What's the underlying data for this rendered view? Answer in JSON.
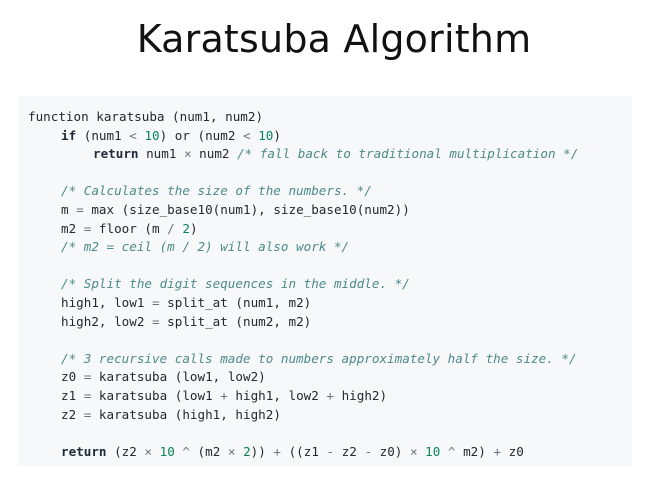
{
  "slide": {
    "title": "Karatsuba Algorithm"
  },
  "code": {
    "l1": {
      "a": "function karatsuba (num1, num2)"
    },
    "l2": {
      "kw": "if",
      "a": " (num1 ",
      "op1": "<",
      "b": " ",
      "n1": "10",
      "c": ") or (num2 ",
      "op2": "<",
      "d": " ",
      "n2": "10",
      "e": ")"
    },
    "l3": {
      "kw": "return",
      "a": " num1 ",
      "op1": "×",
      "b": " num2 ",
      "cm": "/* fall back to traditional multiplication */"
    },
    "l4": {
      "cm": "/* Calculates the size of the numbers. */"
    },
    "l5": {
      "a": "m ",
      "op1": "=",
      "b": " max (size_base10(num1), size_base10(num2))"
    },
    "l6": {
      "a": "m2 ",
      "op1": "=",
      "b": " floor (m ",
      "op2": "/",
      "c": " ",
      "n1": "2",
      "d": ")"
    },
    "l7": {
      "cm": "/* m2 = ceil (m / 2) will also work */"
    },
    "l8": {
      "cm": "/* Split the digit sequences in the middle. */"
    },
    "l9": {
      "a": "high1, low1 ",
      "op1": "=",
      "b": " split_at (num1, m2)"
    },
    "l10": {
      "a": "high2, low2 ",
      "op1": "=",
      "b": " split_at (num2, m2)"
    },
    "l11": {
      "cm": "/* 3 recursive calls made to numbers approximately half the size. */"
    },
    "l12": {
      "a": "z0 ",
      "op1": "=",
      "b": " karatsuba (low1, low2)"
    },
    "l13": {
      "a": "z1 ",
      "op1": "=",
      "b": " karatsuba (low1 ",
      "op2": "+",
      "c": " high1, low2 ",
      "op3": "+",
      "d": " high2)"
    },
    "l14": {
      "a": "z2 ",
      "op1": "=",
      "b": " karatsuba (high1, high2)"
    },
    "l15": {
      "kw": "return",
      "a": " (z2 ",
      "op1": "×",
      "b": " ",
      "n1": "10",
      "c": " ",
      "op2": "^",
      "d": " (m2 ",
      "op3": "×",
      "e": " ",
      "n2": "2",
      "f": ")) ",
      "op4": "+",
      "g": " ((z1 ",
      "op5": "-",
      "h": " z2 ",
      "op6": "-",
      "i": " z0) ",
      "op7": "×",
      "j": " ",
      "n3": "10",
      "k": " ",
      "op8": "^",
      "l": " m2) ",
      "op9": "+",
      "m": " z0"
    }
  }
}
